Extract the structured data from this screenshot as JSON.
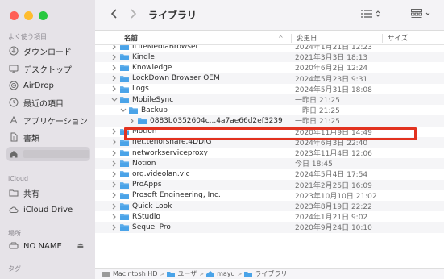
{
  "window": {
    "title": "ライブラリ"
  },
  "sidebar": {
    "section_favorites": "よく使う項目",
    "favorites": [
      {
        "label": "ダウンロード",
        "icon": "download-icon"
      },
      {
        "label": "デスクトップ",
        "icon": "desktop-icon"
      },
      {
        "label": "AirDrop",
        "icon": "airdrop-icon"
      },
      {
        "label": "最近の項目",
        "icon": "clock-icon"
      },
      {
        "label": "アプリケーション",
        "icon": "applications-icon"
      },
      {
        "label": "書類",
        "icon": "document-icon"
      },
      {
        "label": "",
        "icon": "home-icon"
      }
    ],
    "section_icloud": "iCloud",
    "icloud": [
      {
        "label": "共有",
        "icon": "shared-folder-icon"
      },
      {
        "label": "iCloud Drive",
        "icon": "cloud-icon"
      }
    ],
    "section_locations": "場所",
    "locations": [
      {
        "label": "NO NAME",
        "icon": "drive-icon"
      }
    ],
    "section_tags": "タグ"
  },
  "columns": {
    "name": "名前",
    "date": "変更日",
    "size": "サイズ"
  },
  "rows": [
    {
      "name": "iLifeMediaBrowser",
      "date": "2024年1月21日 12:23",
      "level": 0,
      "expanded": false
    },
    {
      "name": "Kindle",
      "date": "2021年3月3日 18:13",
      "level": 0,
      "expanded": false
    },
    {
      "name": "Knowledge",
      "date": "2020年6月2日 12:24",
      "level": 0,
      "expanded": false
    },
    {
      "name": "LockDown Browser OEM",
      "date": "2024年5月23日 9:31",
      "level": 0,
      "expanded": false
    },
    {
      "name": "Logs",
      "date": "2024年5月31日 18:08",
      "level": 0,
      "expanded": false
    },
    {
      "name": "MobileSync",
      "date": "一昨日 21:25",
      "level": 0,
      "expanded": true
    },
    {
      "name": "Backup",
      "date": "一昨日 21:25",
      "level": 1,
      "expanded": true
    },
    {
      "name": "0883b0352604c...4a7ae66d2ef3239",
      "date": "一昨日 21:25",
      "level": 2,
      "expanded": false
    },
    {
      "name": "Motion",
      "date": "2020年11月9日 14:49",
      "level": 0,
      "expanded": false
    },
    {
      "name": "net.tenorshare.4DDiG",
      "date": "2024年6月3日 22:40",
      "level": 0,
      "expanded": false
    },
    {
      "name": "networkserviceproxy",
      "date": "2023年11月4日 12:06",
      "level": 0,
      "expanded": false
    },
    {
      "name": "Notion",
      "date": "今日 18:45",
      "level": 0,
      "expanded": false
    },
    {
      "name": "org.videolan.vlc",
      "date": "2024年5月4日 17:54",
      "level": 0,
      "expanded": false
    },
    {
      "name": "ProApps",
      "date": "2021年2月25日 16:09",
      "level": 0,
      "expanded": false
    },
    {
      "name": "Prosoft Engineering, Inc.",
      "date": "2023年10月10日 21:02",
      "level": 0,
      "expanded": false
    },
    {
      "name": "Quick Look",
      "date": "2023年8月19日 22:22",
      "level": 0,
      "expanded": false
    },
    {
      "name": "RStudio",
      "date": "2024年1月21日 9:02",
      "level": 0,
      "expanded": false
    },
    {
      "name": "Sequel Pro",
      "date": "2020年9月24日 10:10",
      "level": 0,
      "expanded": false
    }
  ],
  "pathbar": [
    {
      "label": "Macintosh HD",
      "icon": "disk-icon"
    },
    {
      "label": "ユーザ",
      "icon": "folder-icon"
    },
    {
      "label": "mayu",
      "icon": "home-icon"
    },
    {
      "label": "ライブラリ",
      "icon": "folder-icon"
    }
  ],
  "colors": {
    "folder": "#4aa3e8",
    "highlight": "#e2321f",
    "sidebar": "#e6e3e8"
  }
}
